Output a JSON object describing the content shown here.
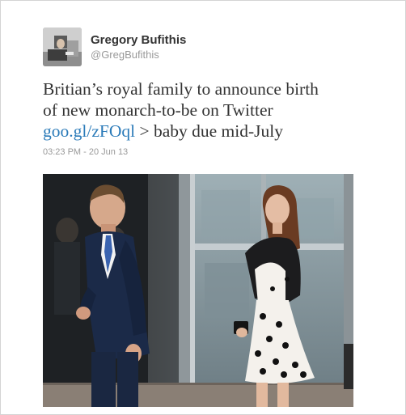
{
  "tweet": {
    "author_name": "Gregory Bufithis",
    "author_handle": "@GregBufithis",
    "text_line1": "Britian’s royal family to announce birth",
    "text_line2": "of new monarch-to-be on Twitter",
    "link_text": "goo.gl/zFOql",
    "text_after_link": " > baby due mid-July",
    "timestamp": "03:23 PM - 20 Jun 13",
    "colors": {
      "link": "#2b7bb9",
      "text": "#333333",
      "meta": "#999999"
    }
  }
}
